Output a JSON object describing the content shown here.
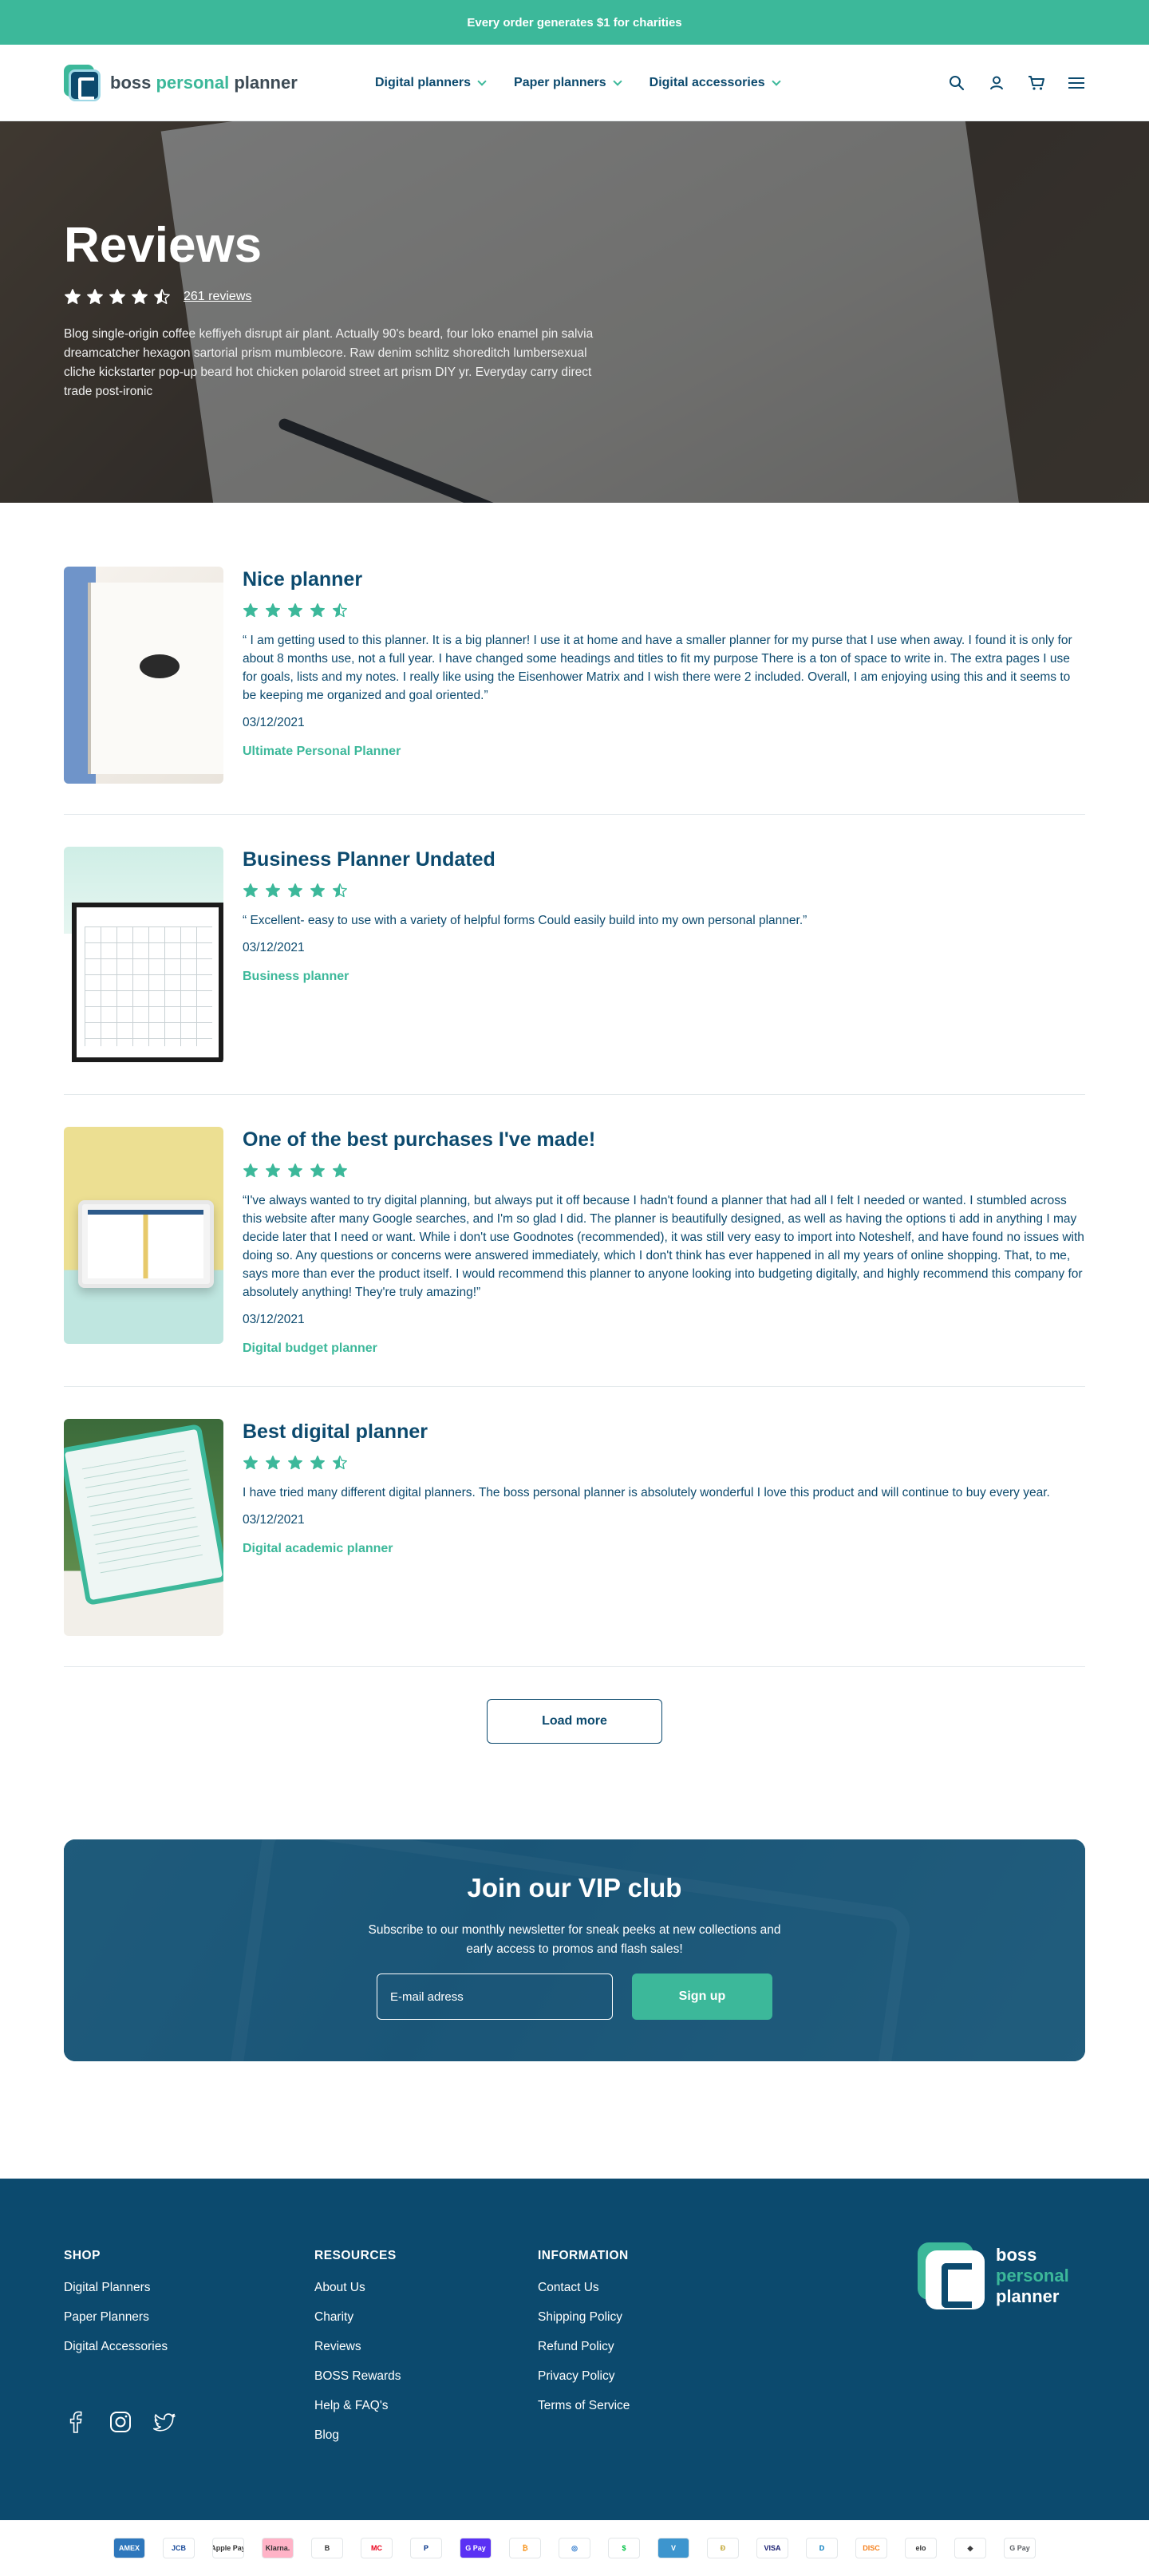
{
  "announcement": "Every order generates $1 for charities",
  "brand": {
    "part1": "boss",
    "part2": "personal",
    "part3": "planner"
  },
  "nav": [
    {
      "label": "Digital planners"
    },
    {
      "label": "Paper planners"
    },
    {
      "label": "Digital accessories"
    }
  ],
  "header_icons": [
    "search-icon",
    "account-icon",
    "cart-icon",
    "menu-icon"
  ],
  "hero": {
    "title": "Reviews",
    "rating": 4.5,
    "reviews_count": "261 reviews",
    "description": "Blog single-origin coffee keffiyeh disrupt air plant. Actually 90's beard, four loko enamel pin salvia dreamcatcher hexagon sartorial prism mumblecore. Raw denim schlitz shoreditch lumbersexual cliche kickstarter pop-up beard hot chicken polaroid street art prism DIY yr. Everyday carry direct trade post-ironic"
  },
  "reviews": [
    {
      "title": "Nice planner",
      "rating": 4.5,
      "text": "“ I am getting used to this planner. It is a big planner! I use it at home and have a smaller planner for my purse that I use when away. I found it is only for about 8 months use, not a full year. I have changed some headings and titles to fit my purpose There is a ton of space to write in. The extra pages I use for goals, lists and my notes. I really like using the Eisenhower Matrix and I wish there were 2 included. Overall, I am enjoying using this and it seems to be keeping me organized and goal oriented.”",
      "date": "03/12/2021",
      "product": "Ultimate Personal Planner"
    },
    {
      "title": "Business Planner Undated",
      "rating": 4.5,
      "text": "“ Excellent- easy to use with a variety of helpful forms Could easily build into my own personal planner.”",
      "date": "03/12/2021",
      "product": "Business planner"
    },
    {
      "title": "One of the best purchases I've made!",
      "rating": 5,
      "text": "“I've always wanted to try digital planning, but always put it off because I hadn't found a planner that had all I felt I needed or wanted. I stumbled across this website after many Google searches, and I'm so glad I did. The planner is beautifully designed, as well as having the options ti add in anything I may decide later that I need or want. While i don't use Goodnotes (recommended), it was still very easy to import into Noteshelf, and have found no issues with doing so. Any questions or concerns were answered immediately, which I don't think has ever happened in all my years of online shopping. That, to me, says more than ever the product itself. I would recommend this planner to anyone looking into budgeting digitally, and highly recommend this company for absolutely anything! They're truly amazing!”",
      "date": "03/12/2021",
      "product": "Digital budget planner"
    },
    {
      "title": "Best digital planner",
      "rating": 4.5,
      "text": "I have tried many different digital planners. The boss personal planner is absolutely wonderful I love this product and will continue to buy every year.",
      "date": "03/12/2021",
      "product": "Digital academic planner"
    }
  ],
  "load_more": "Load more",
  "vip": {
    "title": "Join our VIP club",
    "text": "Subscribe to our monthly newsletter for sneak peeks at new collections and early access to promos and flash sales!",
    "email_placeholder": "E-mail adress",
    "button": "Sign up"
  },
  "footer": {
    "shop": {
      "heading": "SHOP",
      "links": [
        "Digital Planners",
        "Paper Planners",
        "Digital Accessories"
      ]
    },
    "resources": {
      "heading": "RESOURCES",
      "links": [
        "About Us",
        "Charity",
        "Reviews",
        "BOSS Rewards",
        "Help & FAQ's",
        "Blog"
      ]
    },
    "information": {
      "heading": "INFORMATION",
      "links": [
        "Contact Us",
        "Shipping Policy",
        "Refund Policy",
        "Privacy Policy",
        "Terms of Service"
      ]
    },
    "socials": [
      "facebook-icon",
      "instagram-icon",
      "twitter-icon"
    ]
  },
  "payments": [
    "AMEX",
    "JCB",
    "Apple Pay",
    "Klarna.",
    "B",
    "MC",
    "P",
    "G Pay",
    "₿",
    "◎",
    "$",
    "V",
    "Ð",
    "VISA",
    "D",
    "DISC",
    "elo",
    "◆",
    "G Pay"
  ],
  "colors": {
    "accent": "#3cb89a",
    "navy": "#0c4a6e"
  }
}
